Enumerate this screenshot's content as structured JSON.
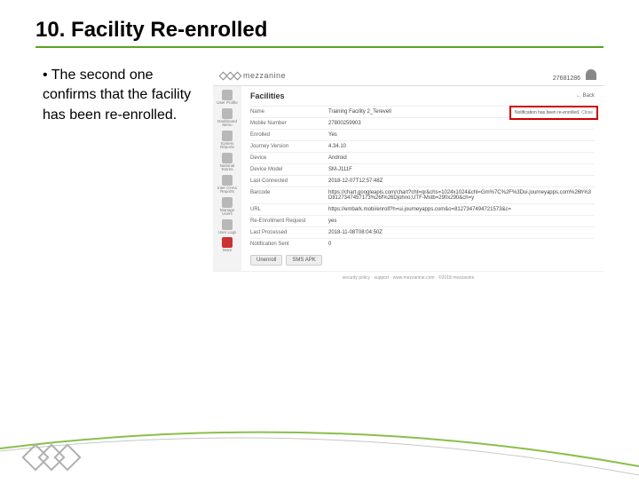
{
  "slide": {
    "title_prefix": "10. ",
    "title_main": "Facility Re-enrolled",
    "bullet": "The second one confirms that the facility has been re-enrolled."
  },
  "app": {
    "brand": "mezzanine",
    "user_id": "27681286",
    "sidebar": [
      {
        "label": "User Profile"
      },
      {
        "label": "Dashboard Menu"
      },
      {
        "label": "System Reports"
      },
      {
        "label": "National Stores"
      },
      {
        "label": "Inter CHAs Reports"
      },
      {
        "label": "Manage Users"
      },
      {
        "label": "User Logs"
      },
      {
        "label": "More",
        "red": true
      }
    ],
    "heading": "Facilities",
    "back": "← Back",
    "rows": [
      {
        "label": "Name",
        "value": "Training Facility 2_Terevell"
      },
      {
        "label": "Mobile Number",
        "value": "27800259903"
      },
      {
        "label": "Enrolled",
        "value": "Yes"
      },
      {
        "label": "Journey Version",
        "value": "4.34.10"
      },
      {
        "label": "Device",
        "value": "Android"
      },
      {
        "label": "Device Model",
        "value": "SM-J111F"
      },
      {
        "label": "Last Connected",
        "value": "2018-12-07T12:57:48Z"
      },
      {
        "label": "Barcode",
        "value": "https://chart.googleapis.com/chart?cht=qr&chs=1024x1024&chl=Gm%7C%2F%3Dui.journeyapps.com%26h%3D8127347457173%26f%26Djohno;UTF-Mstb=290x290&ch=y"
      },
      {
        "label": "URL",
        "value": "https://embark.mobi/enroll?h=ui.journeyapps.com&o=8127347494721573&c="
      },
      {
        "label": "Re-Enrollment Request",
        "value": "yes"
      },
      {
        "label": "Last Processed",
        "value": "2018-11-08T08:04:50Z"
      },
      {
        "label": "Notification Sent",
        "value": "0"
      }
    ],
    "buttons": {
      "unenroll": "Unenroll",
      "sms": "SMS APK"
    },
    "toast": {
      "text": "Notification has been re-enrolled.",
      "close": "Close"
    },
    "footer": "security policy · support · www.mezzanine.com · ©2018 mezzanine"
  }
}
